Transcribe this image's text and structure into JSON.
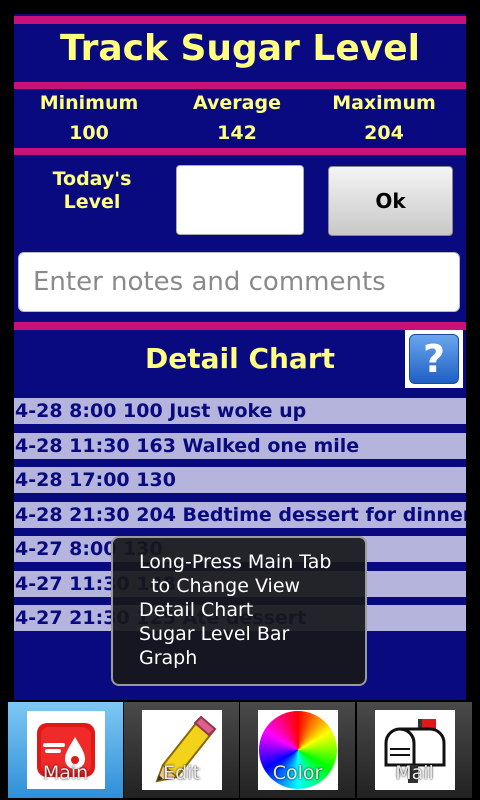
{
  "header": {
    "title": "Track Sugar Level"
  },
  "stats": [
    {
      "label": "Minimum",
      "value": "100"
    },
    {
      "label": "Average",
      "value": "142"
    },
    {
      "label": "Maximum",
      "value": "204"
    }
  ],
  "entry": {
    "today_label": "Today's Level",
    "level_value": "",
    "ok_label": "Ok",
    "notes_placeholder": "Enter notes and comments"
  },
  "detail": {
    "title": "Detail Chart",
    "help_symbol": "?",
    "rows": [
      "4-28 8:00 100 Just woke up",
      "4-28 11:30 163 Walked one mile",
      "4-28 17:00 130",
      "4-28 21:30 204 Bedtime dessert for dinner",
      "4-27 8:00 130",
      "4-27 11:30 148",
      "4-27 21:30 125 Ate dessert"
    ]
  },
  "toast": {
    "lines": [
      "Long-Press Main Tab",
      "  to Change View",
      "Detail Chart",
      "Sugar Level Bar",
      "Graph"
    ]
  },
  "tabs": [
    {
      "label": "Main",
      "icon": "blood-drop-icon",
      "active": true
    },
    {
      "label": "Edit",
      "icon": "pencil-icon",
      "active": false
    },
    {
      "label": "Color",
      "icon": "color-wheel-icon",
      "active": false
    },
    {
      "label": "Mail",
      "icon": "mailbox-icon",
      "active": false
    }
  ],
  "colors": {
    "background": "#0a0a80",
    "accent_bar": "#c8127a",
    "text": "#ffff80",
    "row_bg": "#b4b4dc"
  }
}
